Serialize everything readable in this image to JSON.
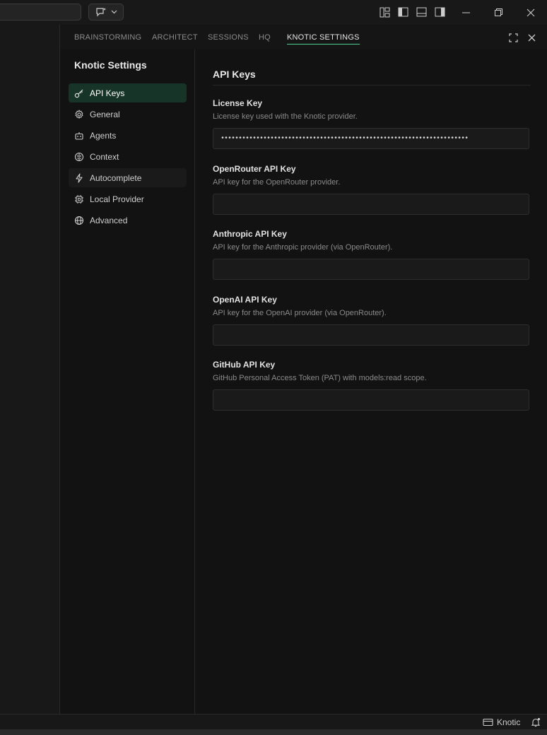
{
  "titlebar": {
    "icons": [
      "layout-customize-icon",
      "toggle-primary-sidebar-icon",
      "toggle-panel-icon",
      "toggle-secondary-sidebar-icon"
    ],
    "window_controls": [
      "minimize-icon",
      "restore-icon",
      "close-icon"
    ]
  },
  "tabs": [
    {
      "label": "BRAINSTORMING",
      "active": false
    },
    {
      "label": "ARCHITECT",
      "active": false
    },
    {
      "label": "SESSIONS",
      "active": false
    },
    {
      "label": "HQ",
      "active": false
    },
    {
      "label": "KNOTIC SETTINGS",
      "active": true
    }
  ],
  "sidebar": {
    "title": "Knotic Settings",
    "items": [
      {
        "label": "API Keys",
        "icon": "key-icon",
        "active": true
      },
      {
        "label": "General",
        "icon": "gear-icon",
        "active": false
      },
      {
        "label": "Agents",
        "icon": "robot-icon",
        "active": false
      },
      {
        "label": "Context",
        "icon": "brain-icon",
        "active": false
      },
      {
        "label": "Autocomplete",
        "icon": "lightning-icon",
        "active": false
      },
      {
        "label": "Local Provider",
        "icon": "chip-icon",
        "active": false
      },
      {
        "label": "Advanced",
        "icon": "globe-icon",
        "active": false
      }
    ]
  },
  "content": {
    "section_title": "API Keys",
    "fields": [
      {
        "label": "License Key",
        "description": "License key used with the Knotic provider.",
        "value": "••••••••••••••••••••••••••••••••••••••••••••••••••••••••••••••••••••••",
        "placeholder": ""
      },
      {
        "label": "OpenRouter API Key",
        "description": "API key for the OpenRouter provider.",
        "value": "",
        "placeholder": ""
      },
      {
        "label": "Anthropic API Key",
        "description": "API key for the Anthropic provider (via OpenRouter).",
        "value": "",
        "placeholder": ""
      },
      {
        "label": "OpenAI API Key",
        "description": "API key for the OpenAI provider (via OpenRouter).",
        "value": "",
        "placeholder": ""
      },
      {
        "label": "GitHub API Key",
        "description": "GitHub Personal Access Token (PAT) with models:read scope.",
        "value": "",
        "placeholder": ""
      }
    ]
  },
  "statusbar": {
    "provider_label": "Knotic"
  },
  "colors": {
    "accent": "#4fcf8f",
    "active_nav_bg": "#173428",
    "editor_bg": "#121212"
  }
}
